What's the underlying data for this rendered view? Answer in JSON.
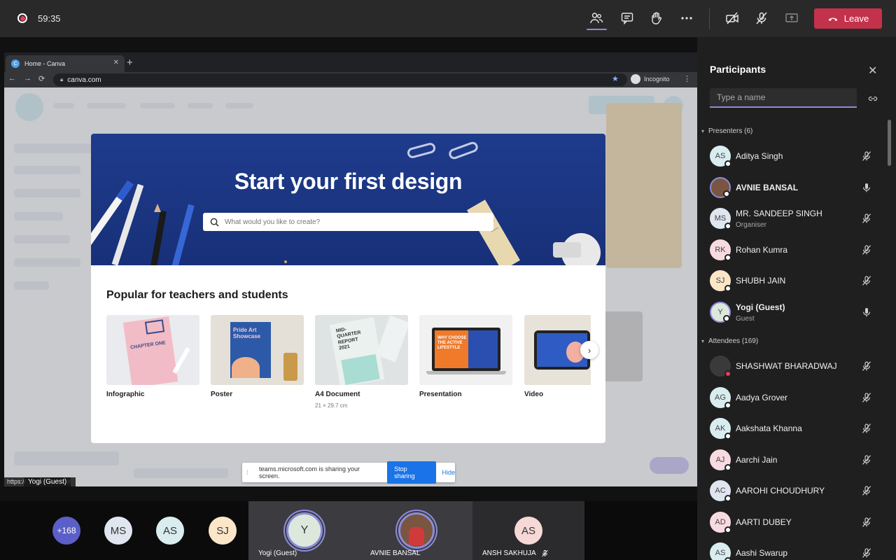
{
  "topbar": {
    "timer": "59:35",
    "leave_label": "Leave"
  },
  "browser": {
    "tab_title": "Home - Canva",
    "tab_favicon": "C",
    "url": "canva.com",
    "incognito_label": "Incognito"
  },
  "canva": {
    "hero_title": "Start your first design",
    "search_placeholder": "What would you like to create?",
    "popular_title": "Popular for teachers and students",
    "cards": [
      {
        "label": "Infographic",
        "sub": "",
        "thumb_text": "CHAPTER ONE"
      },
      {
        "label": "Poster",
        "sub": "",
        "thumb_text": "Pride Art Showcase"
      },
      {
        "label": "A4 Document",
        "sub": "21 × 29.7 cm",
        "thumb_text": "MID-QUARTER REPORT 2021"
      },
      {
        "label": "Presentation",
        "sub": "",
        "thumb_text": "WHY CHOOSE THE ACTIVE LIFESTYLE"
      },
      {
        "label": "Video",
        "sub": "",
        "thumb_text": ""
      }
    ]
  },
  "share_banner": {
    "message": "teams.microsoft.com is sharing your screen.",
    "stop_label": "Stop sharing",
    "hide_label": "Hide"
  },
  "status_url": "https://",
  "status_url_tail": "#",
  "presenter_tag": "Yogi (Guest)",
  "gallery": {
    "overflow_count": "+168",
    "avatars": [
      "MS",
      "AS",
      "SJ"
    ],
    "tiles": [
      {
        "initials": "Y",
        "name": "Yogi (Guest)"
      },
      {
        "initials": "",
        "name": "AVNIE BANSAL"
      },
      {
        "initials": "AS",
        "name": "ANSH SAKHUJA"
      }
    ]
  },
  "panel": {
    "title": "Participants",
    "search_placeholder": "Type a name",
    "presenters_label": "Presenters (6)",
    "attendees_label": "Attendees (169)",
    "presenters": [
      {
        "initials": "AS",
        "name": "Aditya Singh",
        "role": "",
        "mic": "muted"
      },
      {
        "initials": "",
        "name": "AVNIE BANSAL",
        "role": "",
        "mic": "on"
      },
      {
        "initials": "MS",
        "name": "MR. SANDEEP SINGH",
        "role": "Organiser",
        "mic": "muted"
      },
      {
        "initials": "RK",
        "name": "Rohan Kumra",
        "role": "",
        "mic": "muted"
      },
      {
        "initials": "SJ",
        "name": "SHUBH JAIN",
        "role": "",
        "mic": "muted"
      },
      {
        "initials": "Y",
        "name": "Yogi (Guest)",
        "role": "Guest",
        "mic": "on"
      }
    ],
    "attendees": [
      {
        "initials": "",
        "name": "SHASHWAT BHARADWAJ",
        "mic": "muted"
      },
      {
        "initials": "AG",
        "name": "Aadya Grover",
        "mic": "muted"
      },
      {
        "initials": "AK",
        "name": "Aakshata Khanna",
        "mic": "muted"
      },
      {
        "initials": "AJ",
        "name": "Aarchi Jain",
        "mic": "muted"
      },
      {
        "initials": "AC",
        "name": "AAROHI CHOUDHURY",
        "mic": "muted"
      },
      {
        "initials": "AD",
        "name": "AARTI DUBEY",
        "mic": "muted"
      },
      {
        "initials": "AS",
        "name": "Aashi Swarup",
        "mic": "muted"
      }
    ]
  },
  "colors": {
    "accent": "#8b8cd9",
    "leave": "#c4314b",
    "canva_hero": "#1e3b8c"
  }
}
